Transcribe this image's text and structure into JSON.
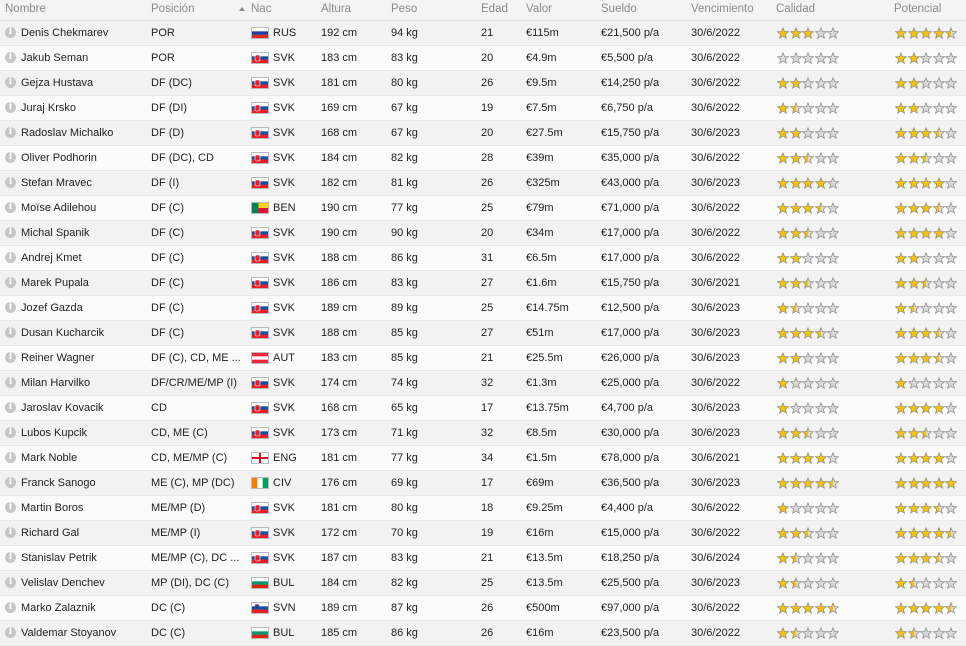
{
  "headers": {
    "name": "Nombre",
    "position": "Posición",
    "nat": "Nac",
    "height": "Altura",
    "weight": "Peso",
    "age": "Edad",
    "value": "Valor",
    "wage": "Sueldo",
    "expiry": "Vencimiento",
    "quality": "Calidad",
    "potential": "Potencial"
  },
  "colors": {
    "star_fill": "#f5c400",
    "star_empty": "#d8d8d8",
    "star_stroke": "#8a8a8a"
  },
  "players": [
    {
      "name": "Denis Chekmarev",
      "position": "POR",
      "nat": "RUS",
      "flag": "flag-russia",
      "height": "192 cm",
      "weight": "94 kg",
      "age": "21",
      "value": "€115m",
      "wage": "€21,500 p/a",
      "expiry": "30/6/2022",
      "quality": 3,
      "potential": 4.5
    },
    {
      "name": "Jakub Seman",
      "position": "POR",
      "nat": "SVK",
      "flag": "flag-slovakia",
      "height": "183 cm",
      "weight": "83 kg",
      "age": "20",
      "value": "€4.9m",
      "wage": "€5,500 p/a",
      "expiry": "30/6/2022",
      "quality": 0,
      "potential": 2
    },
    {
      "name": "Gejza Hustava",
      "position": "DF (DC)",
      "nat": "SVK",
      "flag": "flag-slovakia",
      "height": "181 cm",
      "weight": "80 kg",
      "age": "26",
      "value": "€9.5m",
      "wage": "€14,250 p/a",
      "expiry": "30/6/2022",
      "quality": 2,
      "potential": 2
    },
    {
      "name": "Juraj Krsko",
      "position": "DF (DI)",
      "nat": "SVK",
      "flag": "flag-slovakia",
      "height": "169 cm",
      "weight": "67 kg",
      "age": "19",
      "value": "€7.5m",
      "wage": "€6,750 p/a",
      "expiry": "30/6/2022",
      "quality": 1.5,
      "potential": 2
    },
    {
      "name": "Radoslav Michalko",
      "position": "DF (D)",
      "nat": "SVK",
      "flag": "flag-slovakia",
      "height": "168 cm",
      "weight": "67 kg",
      "age": "20",
      "value": "€27.5m",
      "wage": "€15,750 p/a",
      "expiry": "30/6/2023",
      "quality": 2,
      "potential": 3.5
    },
    {
      "name": "Oliver Podhorin",
      "position": "DF (DC), CD",
      "nat": "SVK",
      "flag": "flag-slovakia",
      "height": "184 cm",
      "weight": "82 kg",
      "age": "28",
      "value": "€39m",
      "wage": "€35,000 p/a",
      "expiry": "30/6/2022",
      "quality": 2.5,
      "potential": 2.5
    },
    {
      "name": "Stefan Mravec",
      "position": "DF (I)",
      "nat": "SVK",
      "flag": "flag-slovakia",
      "height": "182 cm",
      "weight": "81 kg",
      "age": "26",
      "value": "€325m",
      "wage": "€43,000 p/a",
      "expiry": "30/6/2023",
      "quality": 4,
      "potential": 4
    },
    {
      "name": "Moïse Adilehou",
      "position": "DF (C)",
      "nat": "BEN",
      "flag": "flag-benin",
      "height": "190 cm",
      "weight": "77 kg",
      "age": "25",
      "value": "€79m",
      "wage": "€71,000 p/a",
      "expiry": "30/6/2022",
      "quality": 3.5,
      "potential": 3.5
    },
    {
      "name": "Michal Spanik",
      "position": "DF (C)",
      "nat": "SVK",
      "flag": "flag-slovakia",
      "height": "190 cm",
      "weight": "90 kg",
      "age": "20",
      "value": "€34m",
      "wage": "€17,000 p/a",
      "expiry": "30/6/2022",
      "quality": 2.5,
      "potential": 4
    },
    {
      "name": "Andrej Kmet",
      "position": "DF (C)",
      "nat": "SVK",
      "flag": "flag-slovakia",
      "height": "188 cm",
      "weight": "86 kg",
      "age": "31",
      "value": "€6.5m",
      "wage": "€17,000 p/a",
      "expiry": "30/6/2022",
      "quality": 2,
      "potential": 2
    },
    {
      "name": "Marek Pupala",
      "position": "DF (C)",
      "nat": "SVK",
      "flag": "flag-slovakia",
      "height": "186 cm",
      "weight": "83 kg",
      "age": "27",
      "value": "€1.6m",
      "wage": "€15,750 p/a",
      "expiry": "30/6/2021",
      "quality": 2.5,
      "potential": 2.5
    },
    {
      "name": "Jozef Gazda",
      "position": "DF (C)",
      "nat": "SVK",
      "flag": "flag-slovakia",
      "height": "189 cm",
      "weight": "89 kg",
      "age": "25",
      "value": "€14.75m",
      "wage": "€12,500 p/a",
      "expiry": "30/6/2023",
      "quality": 1.5,
      "potential": 1.5
    },
    {
      "name": "Dusan Kucharcik",
      "position": "DF (C)",
      "nat": "SVK",
      "flag": "flag-slovakia",
      "height": "188 cm",
      "weight": "85 kg",
      "age": "27",
      "value": "€51m",
      "wage": "€17,000 p/a",
      "expiry": "30/6/2023",
      "quality": 3.5,
      "potential": 3.5
    },
    {
      "name": "Reiner Wagner",
      "position": "DF (C), CD, ME ...",
      "nat": "AUT",
      "flag": "flag-austria",
      "height": "183 cm",
      "weight": "85 kg",
      "age": "21",
      "value": "€25.5m",
      "wage": "€26,000 p/a",
      "expiry": "30/6/2023",
      "quality": 2,
      "potential": 3.5
    },
    {
      "name": "Milan Harvilko",
      "position": "DF/CR/ME/MP (I)",
      "nat": "SVK",
      "flag": "flag-slovakia",
      "height": "174 cm",
      "weight": "74 kg",
      "age": "32",
      "value": "€1.3m",
      "wage": "€25,000 p/a",
      "expiry": "30/6/2022",
      "quality": 1,
      "potential": 1
    },
    {
      "name": "Jaroslav Kovacik",
      "position": "CD",
      "nat": "SVK",
      "flag": "flag-slovakia",
      "height": "168 cm",
      "weight": "65 kg",
      "age": "17",
      "value": "€13.75m",
      "wage": "€4,700 p/a",
      "expiry": "30/6/2023",
      "quality": 1,
      "potential": 4
    },
    {
      "name": "Lubos Kupcik",
      "position": "CD, ME (C)",
      "nat": "SVK",
      "flag": "flag-slovakia",
      "height": "173 cm",
      "weight": "71 kg",
      "age": "32",
      "value": "€8.5m",
      "wage": "€30,000 p/a",
      "expiry": "30/6/2023",
      "quality": 2.5,
      "potential": 2.5
    },
    {
      "name": "Mark Noble",
      "position": "CD, ME/MP (C)",
      "nat": "ENG",
      "flag": "flag-england",
      "height": "181 cm",
      "weight": "77 kg",
      "age": "34",
      "value": "€1.5m",
      "wage": "€78,000 p/a",
      "expiry": "30/6/2021",
      "quality": 4,
      "potential": 4
    },
    {
      "name": "Franck Sanogo",
      "position": "ME (C), MP (DC)",
      "nat": "CIV",
      "flag": "flag-ivory-coast",
      "height": "176 cm",
      "weight": "69 kg",
      "age": "17",
      "value": "€69m",
      "wage": "€36,500 p/a",
      "expiry": "30/6/2023",
      "quality": 4.5,
      "potential": 5
    },
    {
      "name": "Martin Boros",
      "position": "ME/MP (D)",
      "nat": "SVK",
      "flag": "flag-slovakia",
      "height": "181 cm",
      "weight": "80 kg",
      "age": "18",
      "value": "€9.25m",
      "wage": "€4,400 p/a",
      "expiry": "30/6/2022",
      "quality": 1,
      "potential": 3.5
    },
    {
      "name": "Richard Gal",
      "position": "ME/MP (I)",
      "nat": "SVK",
      "flag": "flag-slovakia",
      "height": "172 cm",
      "weight": "70 kg",
      "age": "19",
      "value": "€16m",
      "wage": "€15,000 p/a",
      "expiry": "30/6/2022",
      "quality": 2.5,
      "potential": 4.5
    },
    {
      "name": "Stanislav Petrik",
      "position": "ME/MP (C), DC ...",
      "nat": "SVK",
      "flag": "flag-slovakia",
      "height": "187 cm",
      "weight": "83 kg",
      "age": "21",
      "value": "€13.5m",
      "wage": "€18,250 p/a",
      "expiry": "30/6/2024",
      "quality": 1.5,
      "potential": 3.5
    },
    {
      "name": "Velislav Denchev",
      "position": "MP (DI), DC (C)",
      "nat": "BUL",
      "flag": "flag-bulgaria",
      "height": "184 cm",
      "weight": "82 kg",
      "age": "25",
      "value": "€13.5m",
      "wage": "€25,500 p/a",
      "expiry": "30/6/2023",
      "quality": 1.5,
      "potential": 1.5
    },
    {
      "name": "Marko Zalaznik",
      "position": "DC (C)",
      "nat": "SVN",
      "flag": "flag-slovenia",
      "height": "189 cm",
      "weight": "87 kg",
      "age": "26",
      "value": "€500m",
      "wage": "€97,000 p/a",
      "expiry": "30/6/2022",
      "quality": 4.5,
      "potential": 4.5
    },
    {
      "name": "Valdemar Stoyanov",
      "position": "DC (C)",
      "nat": "BUL",
      "flag": "flag-bulgaria",
      "height": "185 cm",
      "weight": "86 kg",
      "age": "26",
      "value": "€16m",
      "wage": "€23,500 p/a",
      "expiry": "30/6/2022",
      "quality": 1.5,
      "potential": 1.5
    }
  ]
}
